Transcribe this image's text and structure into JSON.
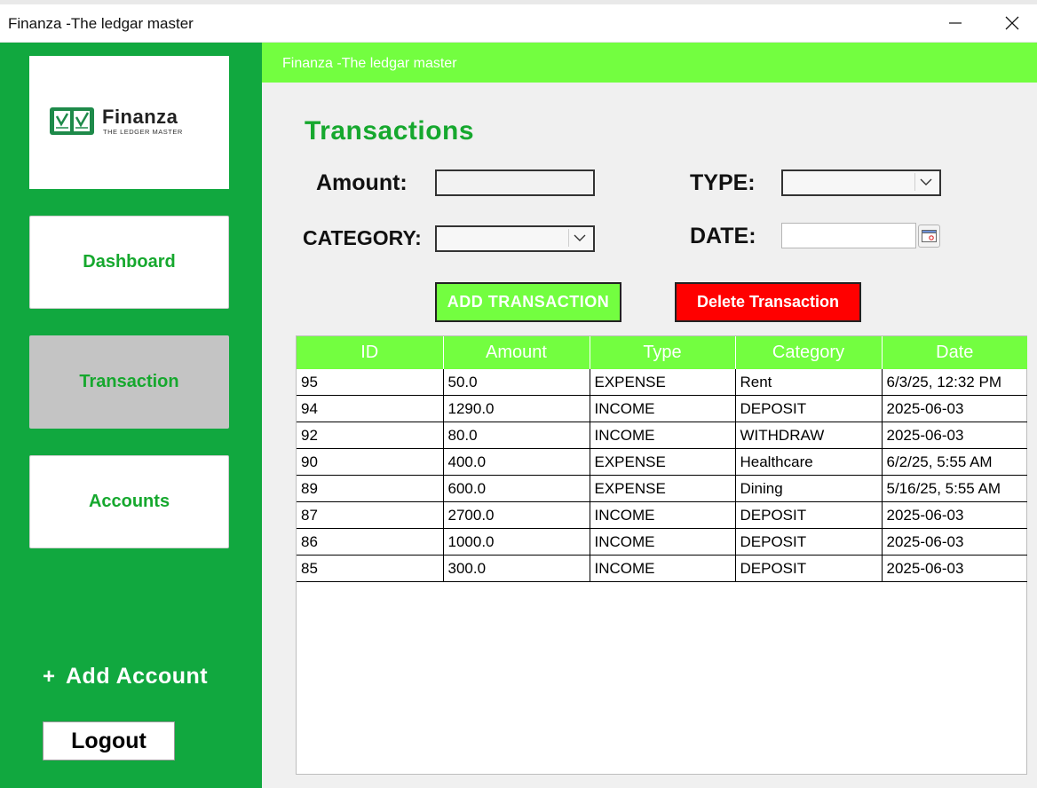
{
  "window": {
    "title": "Finanza -The ledgar master",
    "minimize_icon": "minimize-icon",
    "close_icon": "close-icon"
  },
  "sidebar": {
    "logo": {
      "name": "Finanza",
      "tagline": "THE LEDGER MASTER",
      "colors": {
        "mark": "#1e8a4a",
        "text": "#222222"
      }
    },
    "nav": [
      {
        "label": "Dashboard",
        "active": false
      },
      {
        "label": "Transaction",
        "active": true
      },
      {
        "label": "Accounts",
        "active": false
      }
    ],
    "add_account": {
      "icon": "+",
      "label": "Add Account"
    },
    "logout_label": "Logout"
  },
  "header": {
    "title": "Finanza -The ledgar master"
  },
  "main": {
    "heading": "Transactions",
    "form": {
      "amount_label": "Amount:",
      "amount_value": "",
      "type_label": "TYPE:",
      "type_value": "",
      "category_label": "CATEGORY:",
      "category_value": "",
      "date_label": "DATE:",
      "date_value": ""
    },
    "buttons": {
      "add": "ADD TRANSACTION",
      "delete": "Delete Transaction"
    },
    "table": {
      "columns": [
        "ID",
        "Amount",
        "Type",
        "Category",
        "Date"
      ],
      "rows": [
        [
          "95",
          "50.0",
          "EXPENSE",
          "Rent",
          "6/3/25, 12:32 PM"
        ],
        [
          "94",
          "1290.0",
          "INCOME",
          "DEPOSIT",
          "2025-06-03"
        ],
        [
          "92",
          "80.0",
          "INCOME",
          "WITHDRAW",
          "2025-06-03"
        ],
        [
          "90",
          "400.0",
          "EXPENSE",
          "Healthcare",
          "6/2/25, 5:55 AM"
        ],
        [
          "89",
          "600.0",
          "EXPENSE",
          "Dining",
          "5/16/25, 5:55 AM"
        ],
        [
          "87",
          "2700.0",
          "INCOME",
          "DEPOSIT",
          "2025-06-03"
        ],
        [
          "86",
          "1000.0",
          "INCOME",
          "DEPOSIT",
          "2025-06-03"
        ],
        [
          "85",
          "300.0",
          "INCOME",
          "DEPOSIT",
          "2025-06-03"
        ]
      ]
    }
  },
  "colors": {
    "sidebar": "#11a83f",
    "accent_green": "#73fe40",
    "heading_green": "#16a82e",
    "delete_red": "#ff0000"
  }
}
